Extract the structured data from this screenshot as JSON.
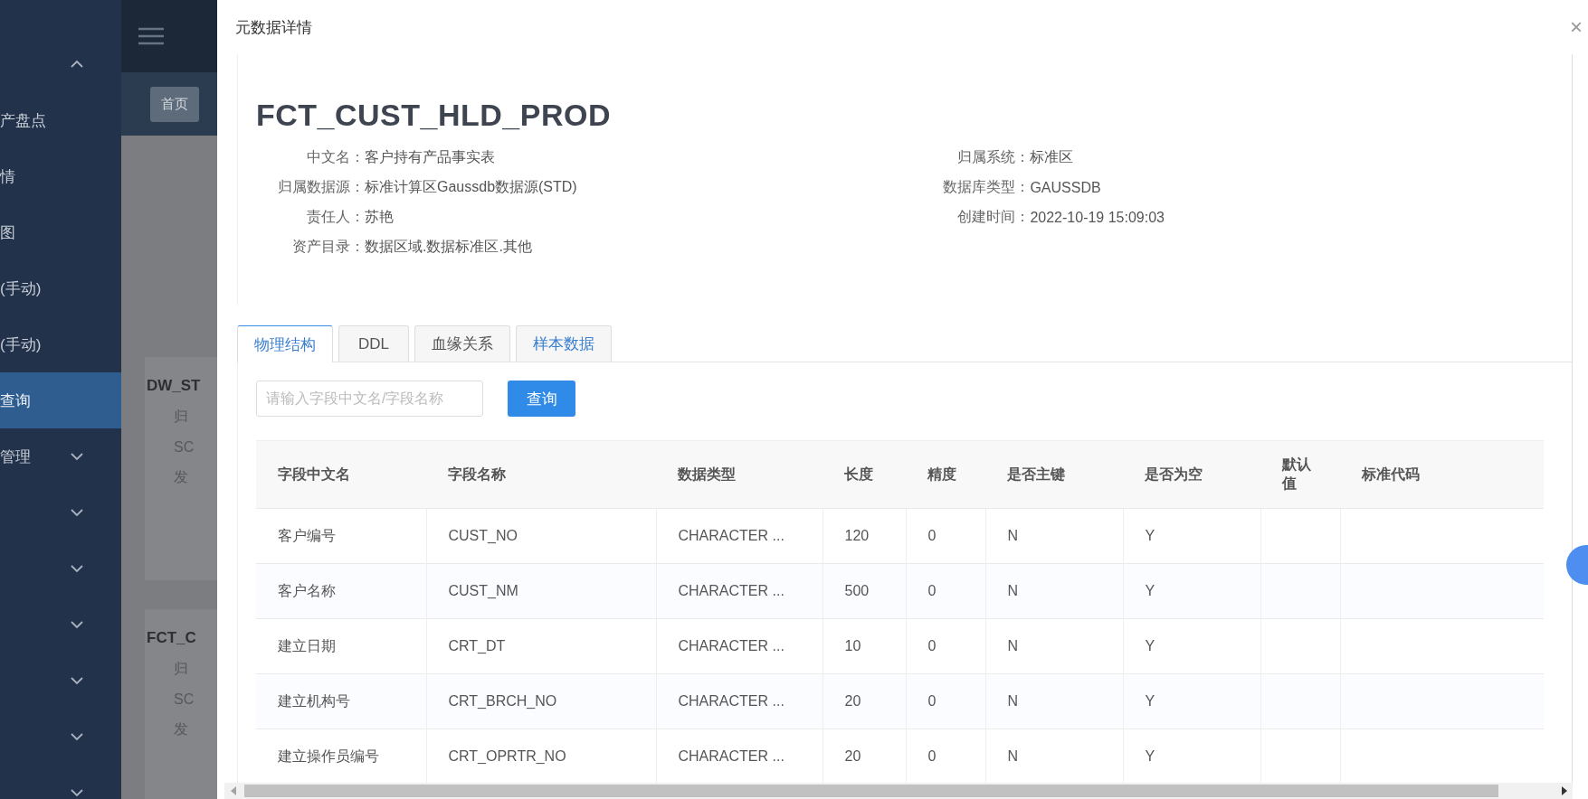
{
  "sidebar": {
    "items": [
      {
        "kind": "group",
        "expanded": true,
        "selected": false
      },
      {
        "label": "产盘点",
        "selected": false
      },
      {
        "label": "情",
        "selected": false
      },
      {
        "label": "图",
        "selected": false
      },
      {
        "label": "(手动)",
        "selected": false
      },
      {
        "label": "(手动)",
        "selected": false
      },
      {
        "label": "查询",
        "selected": true
      },
      {
        "label": "管理",
        "kind": "group",
        "expanded": false,
        "selected": false
      },
      {
        "kind": "group",
        "expanded": false,
        "selected": false
      },
      {
        "kind": "group",
        "expanded": false,
        "selected": false
      },
      {
        "kind": "group",
        "expanded": false,
        "selected": false
      },
      {
        "kind": "group",
        "expanded": false,
        "selected": false
      },
      {
        "kind": "group",
        "expanded": false,
        "selected": false
      },
      {
        "kind": "group",
        "expanded": false,
        "selected": false
      }
    ]
  },
  "background_page": {
    "tags": [
      "首页"
    ],
    "cards": [
      {
        "title": "DW_ST",
        "lines": [
          "归",
          "SC",
          "发"
        ]
      },
      {
        "title": "FCT_C",
        "lines": [
          "归",
          "SC",
          "发"
        ]
      }
    ]
  },
  "dialog": {
    "title": "元数据详情",
    "close": "×",
    "table_name": "FCT_CUST_HLD_PROD",
    "info_left": [
      {
        "label": "中文名：",
        "value": "客户持有产品事实表"
      },
      {
        "label": "归属数据源：",
        "value": "标准计算区Gaussdb数据源(STD)"
      },
      {
        "label": "责任人：",
        "value": "苏艳"
      },
      {
        "label": "资产目录：",
        "value": "数据区域.数据标准区.其他"
      }
    ],
    "info_right": [
      {
        "label": "归属系统：",
        "value": "标准区"
      },
      {
        "label": "数据库类型：",
        "value": "GAUSSDB"
      },
      {
        "label": "创建时间：",
        "value": "2022-10-19 15:09:03"
      }
    ],
    "tabs": [
      {
        "label": "物理结构",
        "selected": true
      },
      {
        "label": "DDL",
        "selected": false
      },
      {
        "label": "血缘关系",
        "selected": false
      },
      {
        "label": "样本数据",
        "selected": false
      }
    ],
    "search": {
      "placeholder": "请输入字段中文名/字段名称",
      "button": "查询"
    },
    "table": {
      "columns": [
        "字段中文名",
        "字段名称",
        "数据类型",
        "长度",
        "精度",
        "是否主键",
        "是否为空",
        "默认值",
        "标准代码"
      ],
      "rows": [
        [
          "客户编号",
          "CUST_NO",
          "CHARACTER ...",
          "120",
          "0",
          "N",
          "Y"
        ],
        [
          "客户名称",
          "CUST_NM",
          "CHARACTER ...",
          "500",
          "0",
          "N",
          "Y"
        ],
        [
          "建立日期",
          "CRT_DT",
          "CHARACTER ...",
          "10",
          "0",
          "N",
          "Y"
        ],
        [
          "建立机构号",
          "CRT_BRCH_NO",
          "CHARACTER ...",
          "20",
          "0",
          "N",
          "Y"
        ],
        [
          "建立操作员编号",
          "CRT_OPRTR_NO",
          "CHARACTER ...",
          "20",
          "0",
          "N",
          "Y"
        ]
      ]
    }
  }
}
